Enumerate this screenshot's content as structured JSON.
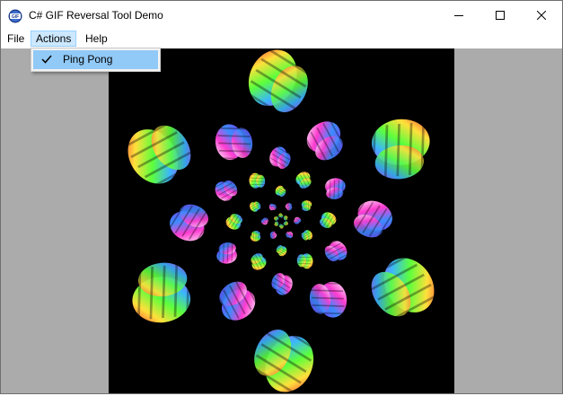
{
  "window": {
    "title": "C# GIF Reversal Tool Demo",
    "app_icon": "gif-tool-app-icon",
    "controls": [
      "minimize-icon",
      "maximize-icon",
      "close-icon"
    ]
  },
  "menubar": {
    "items": [
      {
        "label": "File"
      },
      {
        "label": "Actions",
        "state": "open"
      },
      {
        "label": "Help"
      }
    ]
  },
  "actions_menu": {
    "items": [
      {
        "label": "Ping Pong",
        "checked": true,
        "highlighted": true
      }
    ]
  },
  "canvas": {
    "background": "#000000",
    "content": "animated GIF frame"
  },
  "colors": {
    "client_background": "#ababab",
    "menu_open_highlight": "#cce8ff",
    "dropdown_highlight": "#91c9f7"
  }
}
